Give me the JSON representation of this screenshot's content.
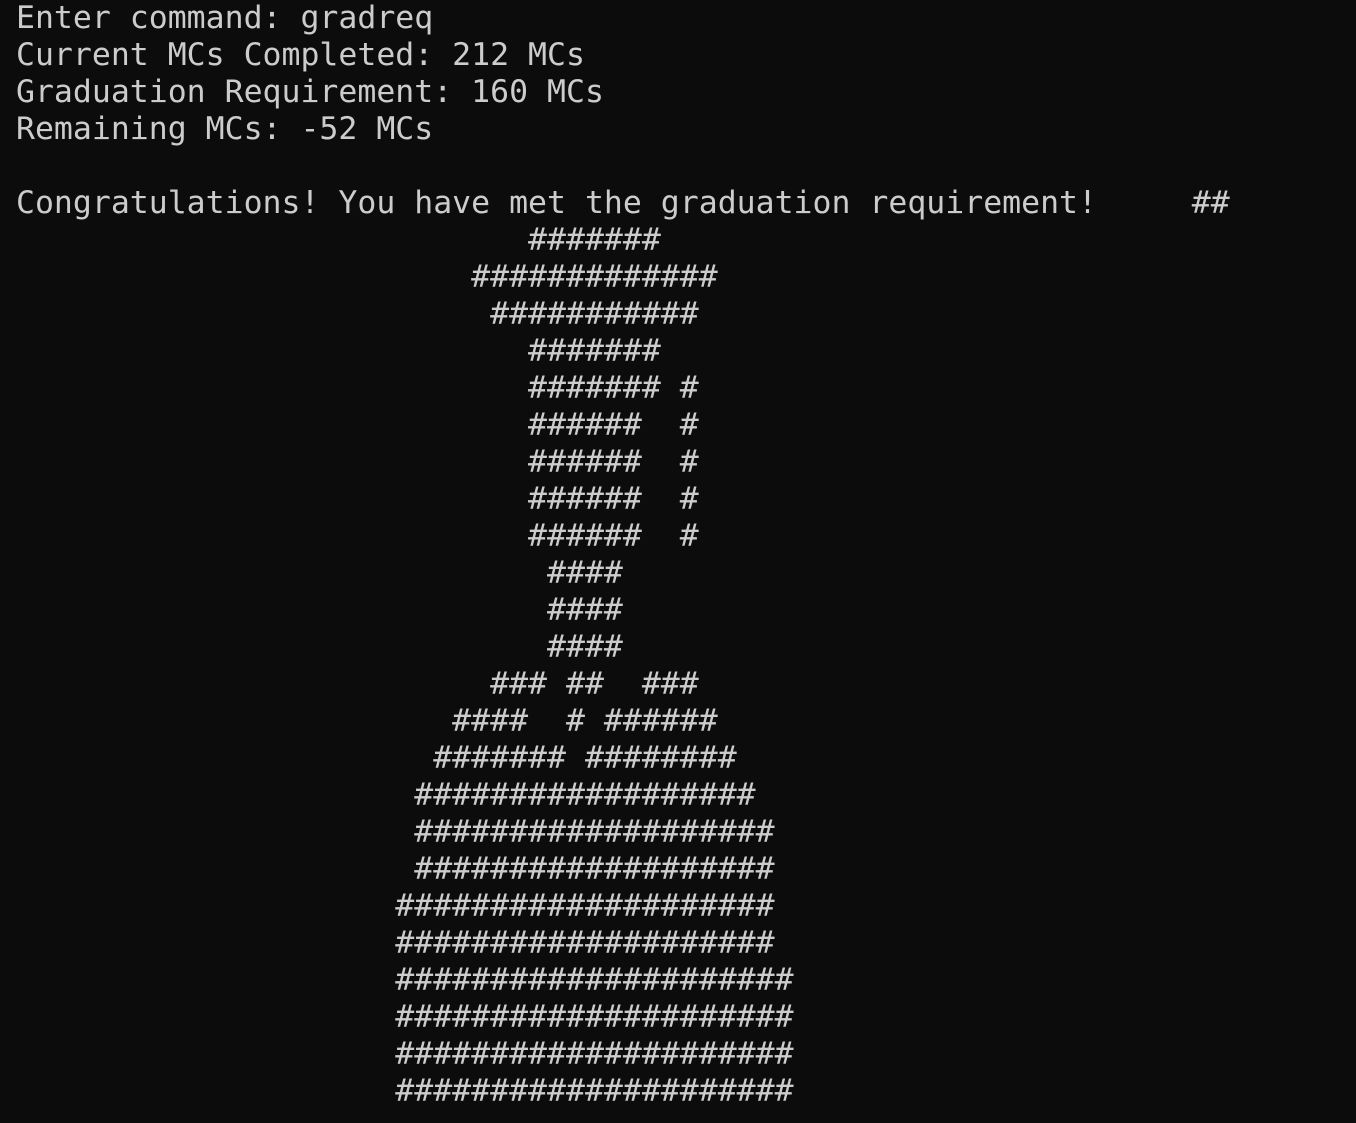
{
  "terminal": {
    "lines": [
      "Enter command: gradreq",
      "Current MCs Completed: 212 MCs",
      "Graduation Requirement: 160 MCs",
      "Remaining MCs: -52 MCs",
      "",
      "Congratulations! You have met the graduation requirement!     ##",
      "                           #######",
      "                        #############",
      "                         ###########",
      "                           #######",
      "                           ####### #",
      "                           ######  #",
      "                           ######  #",
      "                           ######  #",
      "                           ######  #",
      "                            ####",
      "                            ####",
      "                            ####",
      "                         ### ##  ###",
      "                       ####  # ######",
      "                      ####### ########",
      "                     ##################",
      "                     ###################",
      "                     ###################",
      "                    ####################",
      "                    ####################",
      "                    #####################",
      "                    #####################",
      "                    #####################",
      "                    #####################"
    ]
  }
}
